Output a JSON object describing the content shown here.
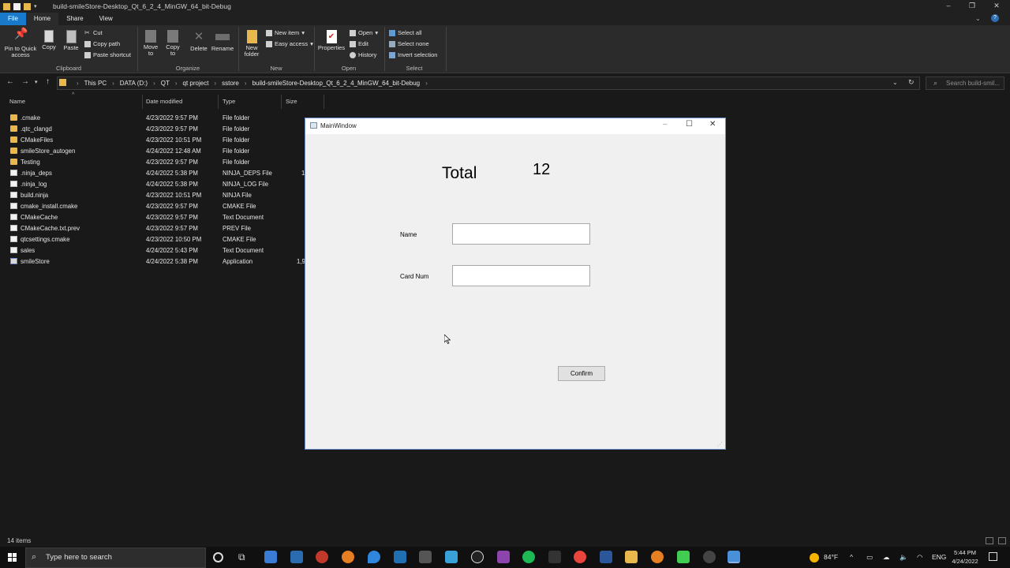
{
  "explorer": {
    "title": "build-smileStore-Desktop_Qt_6_2_4_MinGW_64_bit-Debug",
    "ribbon_tabs": [
      "File",
      "Home",
      "Share",
      "View"
    ],
    "clipboard": {
      "pin": "Pin to Quick access",
      "copy": "Copy",
      "paste": "Paste",
      "cut": "Cut",
      "copy_path": "Copy path",
      "paste_shortcut": "Paste shortcut",
      "group": "Clipboard"
    },
    "organize": {
      "move_to": "Move to",
      "copy_to": "Copy to",
      "delete": "Delete",
      "rename": "Rename",
      "group": "Organize"
    },
    "new": {
      "new_folder": "New folder",
      "new_item": "New item",
      "easy_access": "Easy access",
      "group": "New"
    },
    "open": {
      "properties": "Properties",
      "open": "Open",
      "edit": "Edit",
      "history": "History",
      "group": "Open"
    },
    "select": {
      "select_all": "Select all",
      "select_none": "Select none",
      "invert_selection": "Invert selection",
      "group": "Select"
    },
    "breadcrumb": [
      "This PC",
      "DATA (D:)",
      "QT",
      "qt project",
      "sstore",
      "build-smileStore-Desktop_Qt_6_2_4_MinGW_64_bit-Debug"
    ],
    "search_placeholder": "Search build-smil...",
    "columns": {
      "name": "Name",
      "date": "Date modified",
      "type": "Type",
      "size": "Size"
    },
    "files": [
      {
        "name": ".cmake",
        "date": "4/23/2022 9:57 PM",
        "type": "File folder",
        "size": "",
        "icon": "folder"
      },
      {
        "name": ".qtc_clangd",
        "date": "4/23/2022 9:57 PM",
        "type": "File folder",
        "size": "",
        "icon": "folder"
      },
      {
        "name": "CMakeFiles",
        "date": "4/23/2022 10:51 PM",
        "type": "File folder",
        "size": "",
        "icon": "folder"
      },
      {
        "name": "smileStore_autogen",
        "date": "4/24/2022 12:48 AM",
        "type": "File folder",
        "size": "",
        "icon": "folder"
      },
      {
        "name": "Testing",
        "date": "4/23/2022 9:57 PM",
        "type": "File folder",
        "size": "",
        "icon": "folder"
      },
      {
        "name": ".ninja_deps",
        "date": "4/24/2022 5:38 PM",
        "type": "NINJA_DEPS File",
        "size": "1",
        "icon": "doc"
      },
      {
        "name": ".ninja_log",
        "date": "4/24/2022 5:38 PM",
        "type": "NINJA_LOG File",
        "size": "",
        "icon": "doc"
      },
      {
        "name": "build.ninja",
        "date": "4/23/2022 10:51 PM",
        "type": "NINJA File",
        "size": "",
        "icon": "doc"
      },
      {
        "name": "cmake_install.cmake",
        "date": "4/23/2022 9:57 PM",
        "type": "CMAKE File",
        "size": "",
        "icon": "doc"
      },
      {
        "name": "CMakeCache",
        "date": "4/23/2022 9:57 PM",
        "type": "Text Document",
        "size": "",
        "icon": "doc"
      },
      {
        "name": "CMakeCache.txt.prev",
        "date": "4/23/2022 9:57 PM",
        "type": "PREV File",
        "size": "",
        "icon": "doc"
      },
      {
        "name": "qtcsettings.cmake",
        "date": "4/23/2022 10:50 PM",
        "type": "CMAKE File",
        "size": "",
        "icon": "doc"
      },
      {
        "name": "sales",
        "date": "4/24/2022 5:43 PM",
        "type": "Text Document",
        "size": "",
        "icon": "doc"
      },
      {
        "name": "smileStore",
        "date": "4/24/2022 5:38 PM",
        "type": "Application",
        "size": "1,9",
        "icon": "app"
      }
    ],
    "status": "14 items"
  },
  "qt_window": {
    "title": "MainWindow",
    "total_label": "Total",
    "total_value": "12",
    "name_label": "Name",
    "name_value": "",
    "card_label": "Card Num",
    "card_value": "",
    "confirm_label": "Confirm"
  },
  "taskbar": {
    "search_placeholder": "Type here to search",
    "weather": "84°F",
    "language": "ENG",
    "time": "5:44 PM",
    "date": "4/24/2022"
  },
  "colors": {
    "accent": "#1979ca",
    "folder": "#e8b84d",
    "explorer_bg": "#191919",
    "qt_bg": "#f0f0f0"
  }
}
